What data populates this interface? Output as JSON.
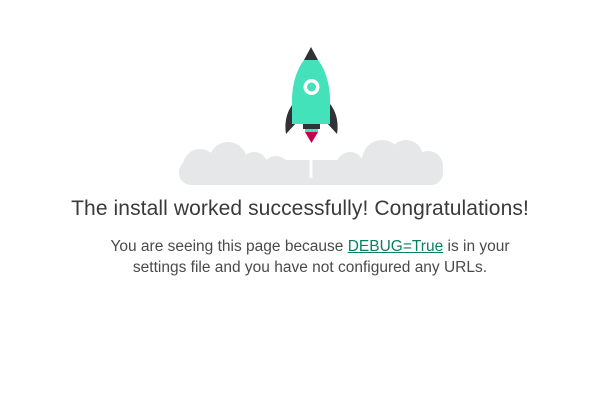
{
  "hero": {
    "title": "The install worked successfully! Congratulations!"
  },
  "message": {
    "before": "You are seeing this page because ",
    "link_text": "DEBUG=True",
    "after": " is in your settings file and you have not configured any URLs."
  },
  "colors": {
    "rocket_body": "#44e2ba",
    "rocket_dark": "#2f3236",
    "rocket_flame": "#c4004f",
    "clouds": "#e6e7e9",
    "title_text": "#3a3a3a",
    "link": "#0c7f63"
  },
  "icons": {
    "rocket": "rocket-icon",
    "clouds": "clouds-icon"
  }
}
